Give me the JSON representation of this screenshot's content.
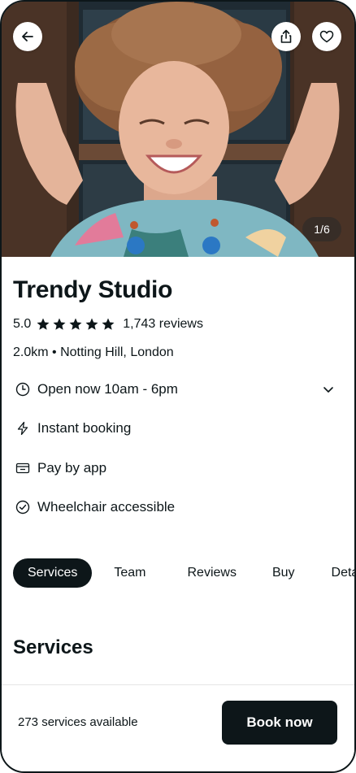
{
  "hero": {
    "pager_label": "1/6",
    "icons": [
      "arrow-left-icon",
      "share-icon",
      "heart-icon"
    ]
  },
  "venue": {
    "name": "Trendy Studio",
    "rating": "5.0",
    "star_count": 5,
    "reviews": "1,743 reviews",
    "location": "2.0km • Notting Hill, London"
  },
  "features": [
    {
      "label": "Open now 10am - 6pm",
      "icon": "clock-icon",
      "expandable": true
    },
    {
      "label": "Instant booking",
      "icon": "lightning-icon"
    },
    {
      "label": "Pay by app",
      "icon": "wallet-icon"
    },
    {
      "label": "Wheelchair accessible",
      "icon": "check-circle-icon"
    }
  ],
  "tabs": [
    {
      "label": "Services",
      "active": true
    },
    {
      "label": "Team"
    },
    {
      "label": "Reviews"
    },
    {
      "label": "Buy"
    },
    {
      "label": "Details"
    }
  ],
  "section": {
    "title": "Services"
  },
  "footer": {
    "services_available": "273 services available",
    "book_label": "Book now"
  },
  "colors": {
    "primary": "#0d1619",
    "background": "#ffffff"
  }
}
